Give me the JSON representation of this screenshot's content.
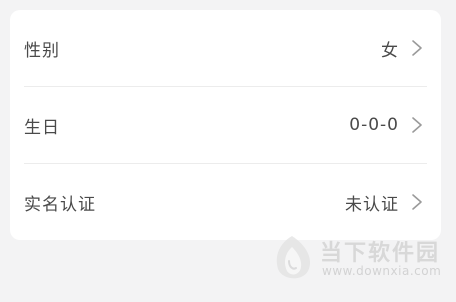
{
  "profile": {
    "rows": [
      {
        "label": "性别",
        "value": "女"
      },
      {
        "label": "生日",
        "value": "0-0-0"
      },
      {
        "label": "实名认证",
        "value": "未认证"
      }
    ]
  },
  "watermark": {
    "title": "当下软件园",
    "url": "www.downxia.com"
  },
  "icons": {
    "chevron": "chevron-right-icon",
    "logo": "downxia-logo-icon"
  },
  "colors": {
    "background": "#f3f3f4",
    "card": "#ffffff",
    "text": "#4a4a4a",
    "chevron": "#9a9a9a",
    "divider": "#ececec",
    "watermark": "#cfcfcf"
  }
}
